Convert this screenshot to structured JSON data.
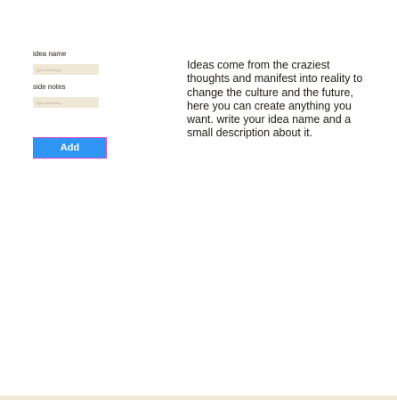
{
  "form": {
    "idea_name_label": "idea name",
    "idea_name_placeholder": "Type something...",
    "idea_name_value": "",
    "side_notes_label": "side notes",
    "side_notes_placeholder": "Type something...",
    "side_notes_value": "",
    "add_button_label": "Add"
  },
  "description": {
    "text": "Ideas come from the craziest thoughts and manifest into reality to change the culture and the future, here you can create anything you want. write your idea name and a small description about it."
  },
  "colors": {
    "input_background": "#f0e8d6",
    "button_background": "#2f95f5",
    "button_border": "#e040c8",
    "footer_strip": "#f0e8d6"
  }
}
